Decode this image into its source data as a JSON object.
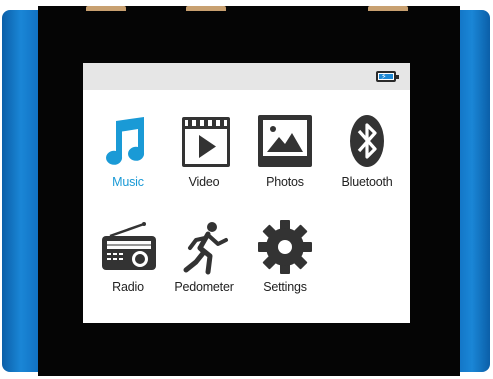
{
  "device": {
    "accent_color": "#1a86d6",
    "bezel_color": "#050505"
  },
  "status_bar": {
    "battery_icon": "battery-charging-icon"
  },
  "menu": {
    "items": [
      {
        "label": "Music",
        "icon": "music-note-icon",
        "selected": true
      },
      {
        "label": "Video",
        "icon": "video-clapper-icon",
        "selected": false
      },
      {
        "label": "Photos",
        "icon": "photo-landscape-icon",
        "selected": false
      },
      {
        "label": "Bluetooth",
        "icon": "bluetooth-icon",
        "selected": false
      },
      {
        "label": "Radio",
        "icon": "radio-icon",
        "selected": false
      },
      {
        "label": "Pedometer",
        "icon": "running-person-icon",
        "selected": false
      },
      {
        "label": "Settings",
        "icon": "gear-icon",
        "selected": false
      }
    ],
    "selected_color": "#1a9ad6"
  }
}
